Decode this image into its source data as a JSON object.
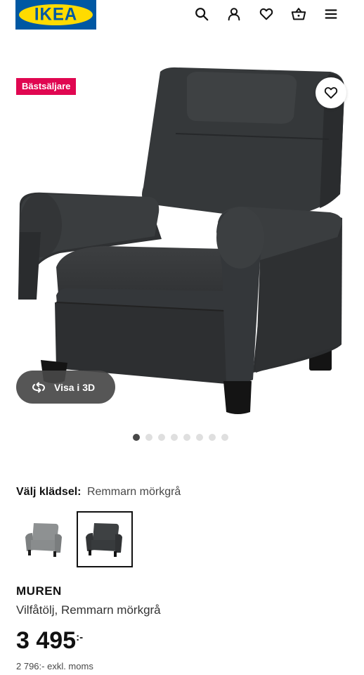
{
  "header": {
    "logo_text": "IKEA",
    "brand_blue": "#0058a3",
    "brand_yellow": "#ffdb00",
    "icons": [
      "search-icon",
      "user-icon",
      "heart-icon",
      "basket-icon",
      "menu-icon"
    ]
  },
  "gallery": {
    "badge": "Bästsäljare",
    "badge_color": "#e00751",
    "view_3d_label": "Visa i 3D",
    "slide_count": 8,
    "active_slide": 1
  },
  "fabric": {
    "label": "Välj klädsel:",
    "value": "Remmarn mörkgrå",
    "options": [
      {
        "name": "light-grey",
        "color": "#8a8c8d",
        "selected": false
      },
      {
        "name": "dark-grey",
        "color": "#3b3d3e",
        "selected": true
      }
    ]
  },
  "product": {
    "name": "MUREN",
    "description": "Vilfåtölj, Remmarn mörkgrå",
    "price": "3 495",
    "currency": ":-",
    "price_excl_vat": "2 796:- exkl. moms"
  }
}
